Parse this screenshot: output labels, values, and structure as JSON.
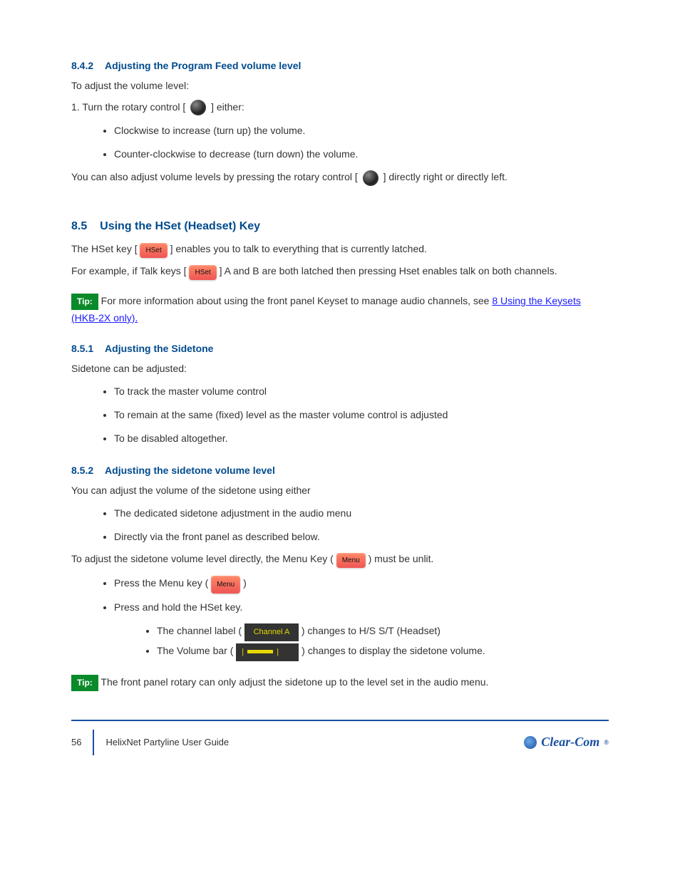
{
  "sections": {
    "s1": {
      "num": "8.4.2",
      "title": "Adjusting the Program Feed volume level",
      "intro": "To adjust the volume level:",
      "step1_prefix": "1.    Turn the rotary control [",
      "step1_suffix": " ] either:",
      "bullets1": [
        "Clockwise to increase (turn up) the volume.",
        "Counter-clockwise to decrease (turn down) the volume."
      ],
      "step2_prefix": "You can also adjust volume levels by pressing the rotary control [",
      "step2_suffix": " ] directly right or directly left."
    },
    "s2": {
      "num": "8.5",
      "title": "Using the HSet (Headset) Key",
      "line1_prefix": "The HSet key [ ",
      "line1_suffix": " ] enables you to talk to everything that is currently latched.",
      "line2_prefix": "For example, if Talk keys [ ",
      "line2_suffix": " ] A and B are both latched then pressing Hset enables talk on both channels.",
      "tip_label": "Tip:",
      "tip_text": " For more information about using the front panel Keyset to manage audio channels, see ",
      "link_text": "8 Using the Keysets (HKB-2X only)."
    },
    "s3": {
      "num": "8.5.1",
      "title": "Adjusting the Sidetone",
      "intro": "Sidetone can be adjusted:",
      "bullets": [
        "To track the master volume control",
        "To remain at the same (fixed) level as the master volume control is adjusted",
        "To be disabled altogether."
      ]
    },
    "s4": {
      "num": "8.5.2",
      "title": "Adjusting the sidetone volume level",
      "intro": "You can adjust the volume of the sidetone using either",
      "bullets": [
        "The dedicated sidetone adjustment in the audio menu",
        "Directly via the front panel as described below."
      ],
      "direct_prefix": "To adjust the sidetone volume level directly, the Menu Key (",
      "direct_suffix": ") must be unlit.",
      "method_bullets": {
        "b1_prefix": "Press the Menu key (",
        "b1_suffix": ")",
        "b2": "Press and hold the HSet key."
      },
      "sub_bullet1_prefix": "The channel label (",
      "sub_bullet1_suffix": ") changes to H/S S/T (Headset)",
      "sub_bullet2_prefix": "The Volume bar (",
      "sub_bullet2_suffix": ") changes to display the sidetone volume.",
      "tip_label": "Tip:",
      "tip_text": " The front panel rotary can only adjust the sidetone up to the level set in the audio menu."
    },
    "icons": {
      "hset": "HSet",
      "menu": "Menu",
      "channel_label": "Channel A"
    },
    "footer": {
      "page": "56",
      "doc": "HelixNet Partyline User Guide"
    },
    "logo": "Clear-Com"
  }
}
